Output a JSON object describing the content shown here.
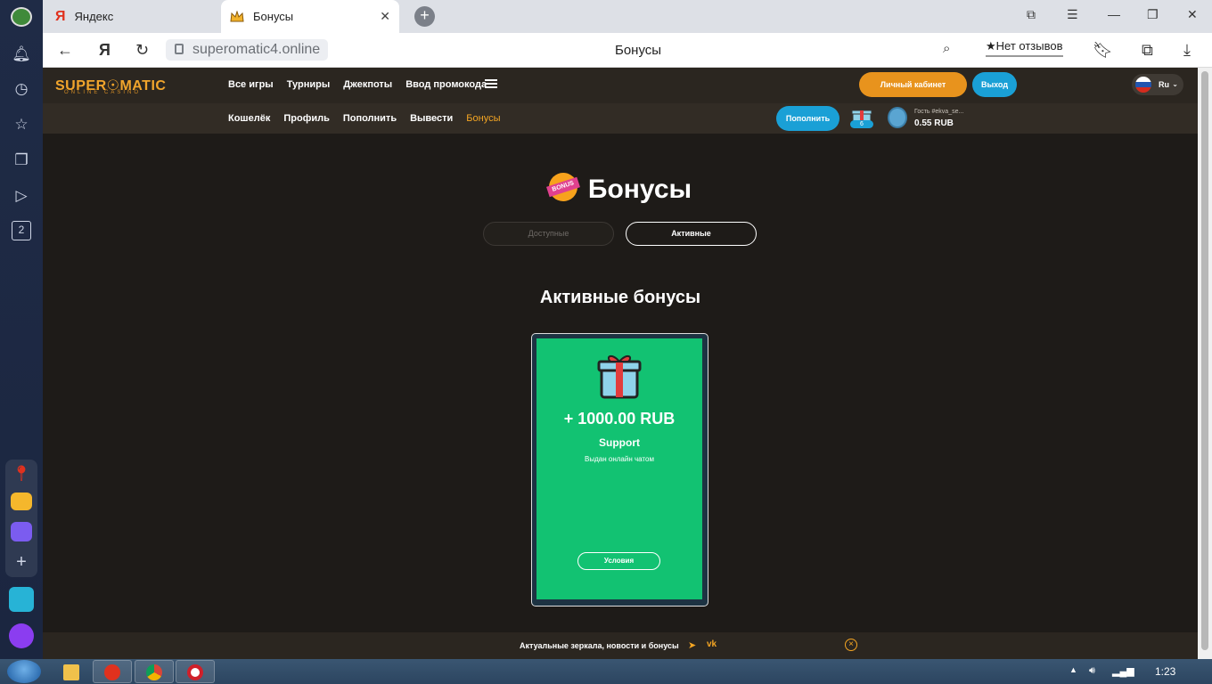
{
  "browser": {
    "tabs": [
      {
        "label": "Яндекс",
        "active": false
      },
      {
        "label": "Бонусы",
        "active": true
      }
    ],
    "address": "superomatic4.online",
    "page_title": "Бонусы",
    "reviews_label": "Нет отзывов",
    "sidebar_badge": "2"
  },
  "site": {
    "logo": "SUPER☉MATIC",
    "logo_sub": "ONLINE CASINO",
    "nav_main": [
      "Все игры",
      "Турниры",
      "Джекпоты",
      "Ввод промокода"
    ],
    "nav_account": [
      "Кошелёк",
      "Профиль",
      "Пополнить",
      "Вывести",
      "Бонусы"
    ],
    "cabinet_button": "Личный кабинет",
    "exit_button": "Выход",
    "language": "Ru",
    "deposit_button": "Пополнить",
    "gift_count": "6",
    "guest_label": "Гость #ekva_se...",
    "balance": "0.55 RUB",
    "heading": "Бонусы",
    "bonus_icon_text": "BONUS",
    "tabs": {
      "available": "Доступные",
      "active": "Активные"
    },
    "section_heading": "Активные бонусы",
    "card": {
      "amount": "+ 1000.00 RUB",
      "title": "Support",
      "description": "Выдан онлайн чатом",
      "button": "Условия"
    },
    "footer_text": "Актуальные зеркала, новости и бонусы"
  },
  "taskbar": {
    "clock": "1:23"
  },
  "colors": {
    "accent": "#f5a623",
    "card_green": "#12c272",
    "blue_button": "#1aa0d6"
  }
}
